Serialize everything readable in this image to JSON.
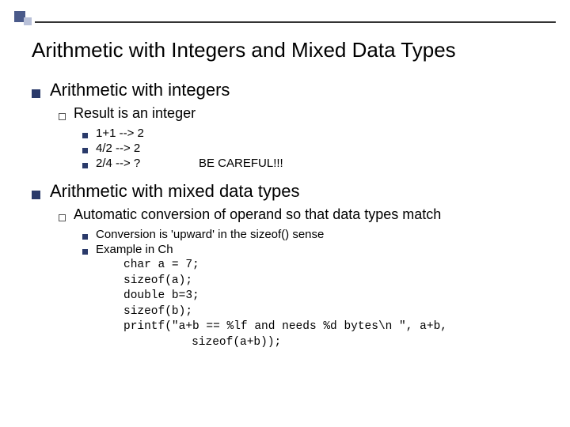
{
  "title": "Arithmetic with Integers and Mixed Data Types",
  "sections": [
    {
      "heading": "Arithmetic with integers",
      "sub": {
        "text": "Result is an integer",
        "examples": [
          {
            "expr": "1+1 --> 2",
            "note": ""
          },
          {
            "expr": "4/2 --> 2",
            "note": ""
          },
          {
            "expr": "2/4 --> ?",
            "note": "BE CAREFUL!!!"
          }
        ]
      }
    },
    {
      "heading": "Arithmetic with mixed data types",
      "sub": {
        "text": "Automatic conversion of operand so that data types match",
        "points": [
          "Conversion is 'upward' in the sizeof() sense",
          "Example in Ch"
        ],
        "code": [
          "char a = 7;",
          "sizeof(a);",
          "double b=3;",
          "sizeof(b);",
          "printf(\"a+b == %lf and needs %d bytes\\n \", a+b,",
          "   sizeof(a+b));"
        ]
      }
    }
  ]
}
